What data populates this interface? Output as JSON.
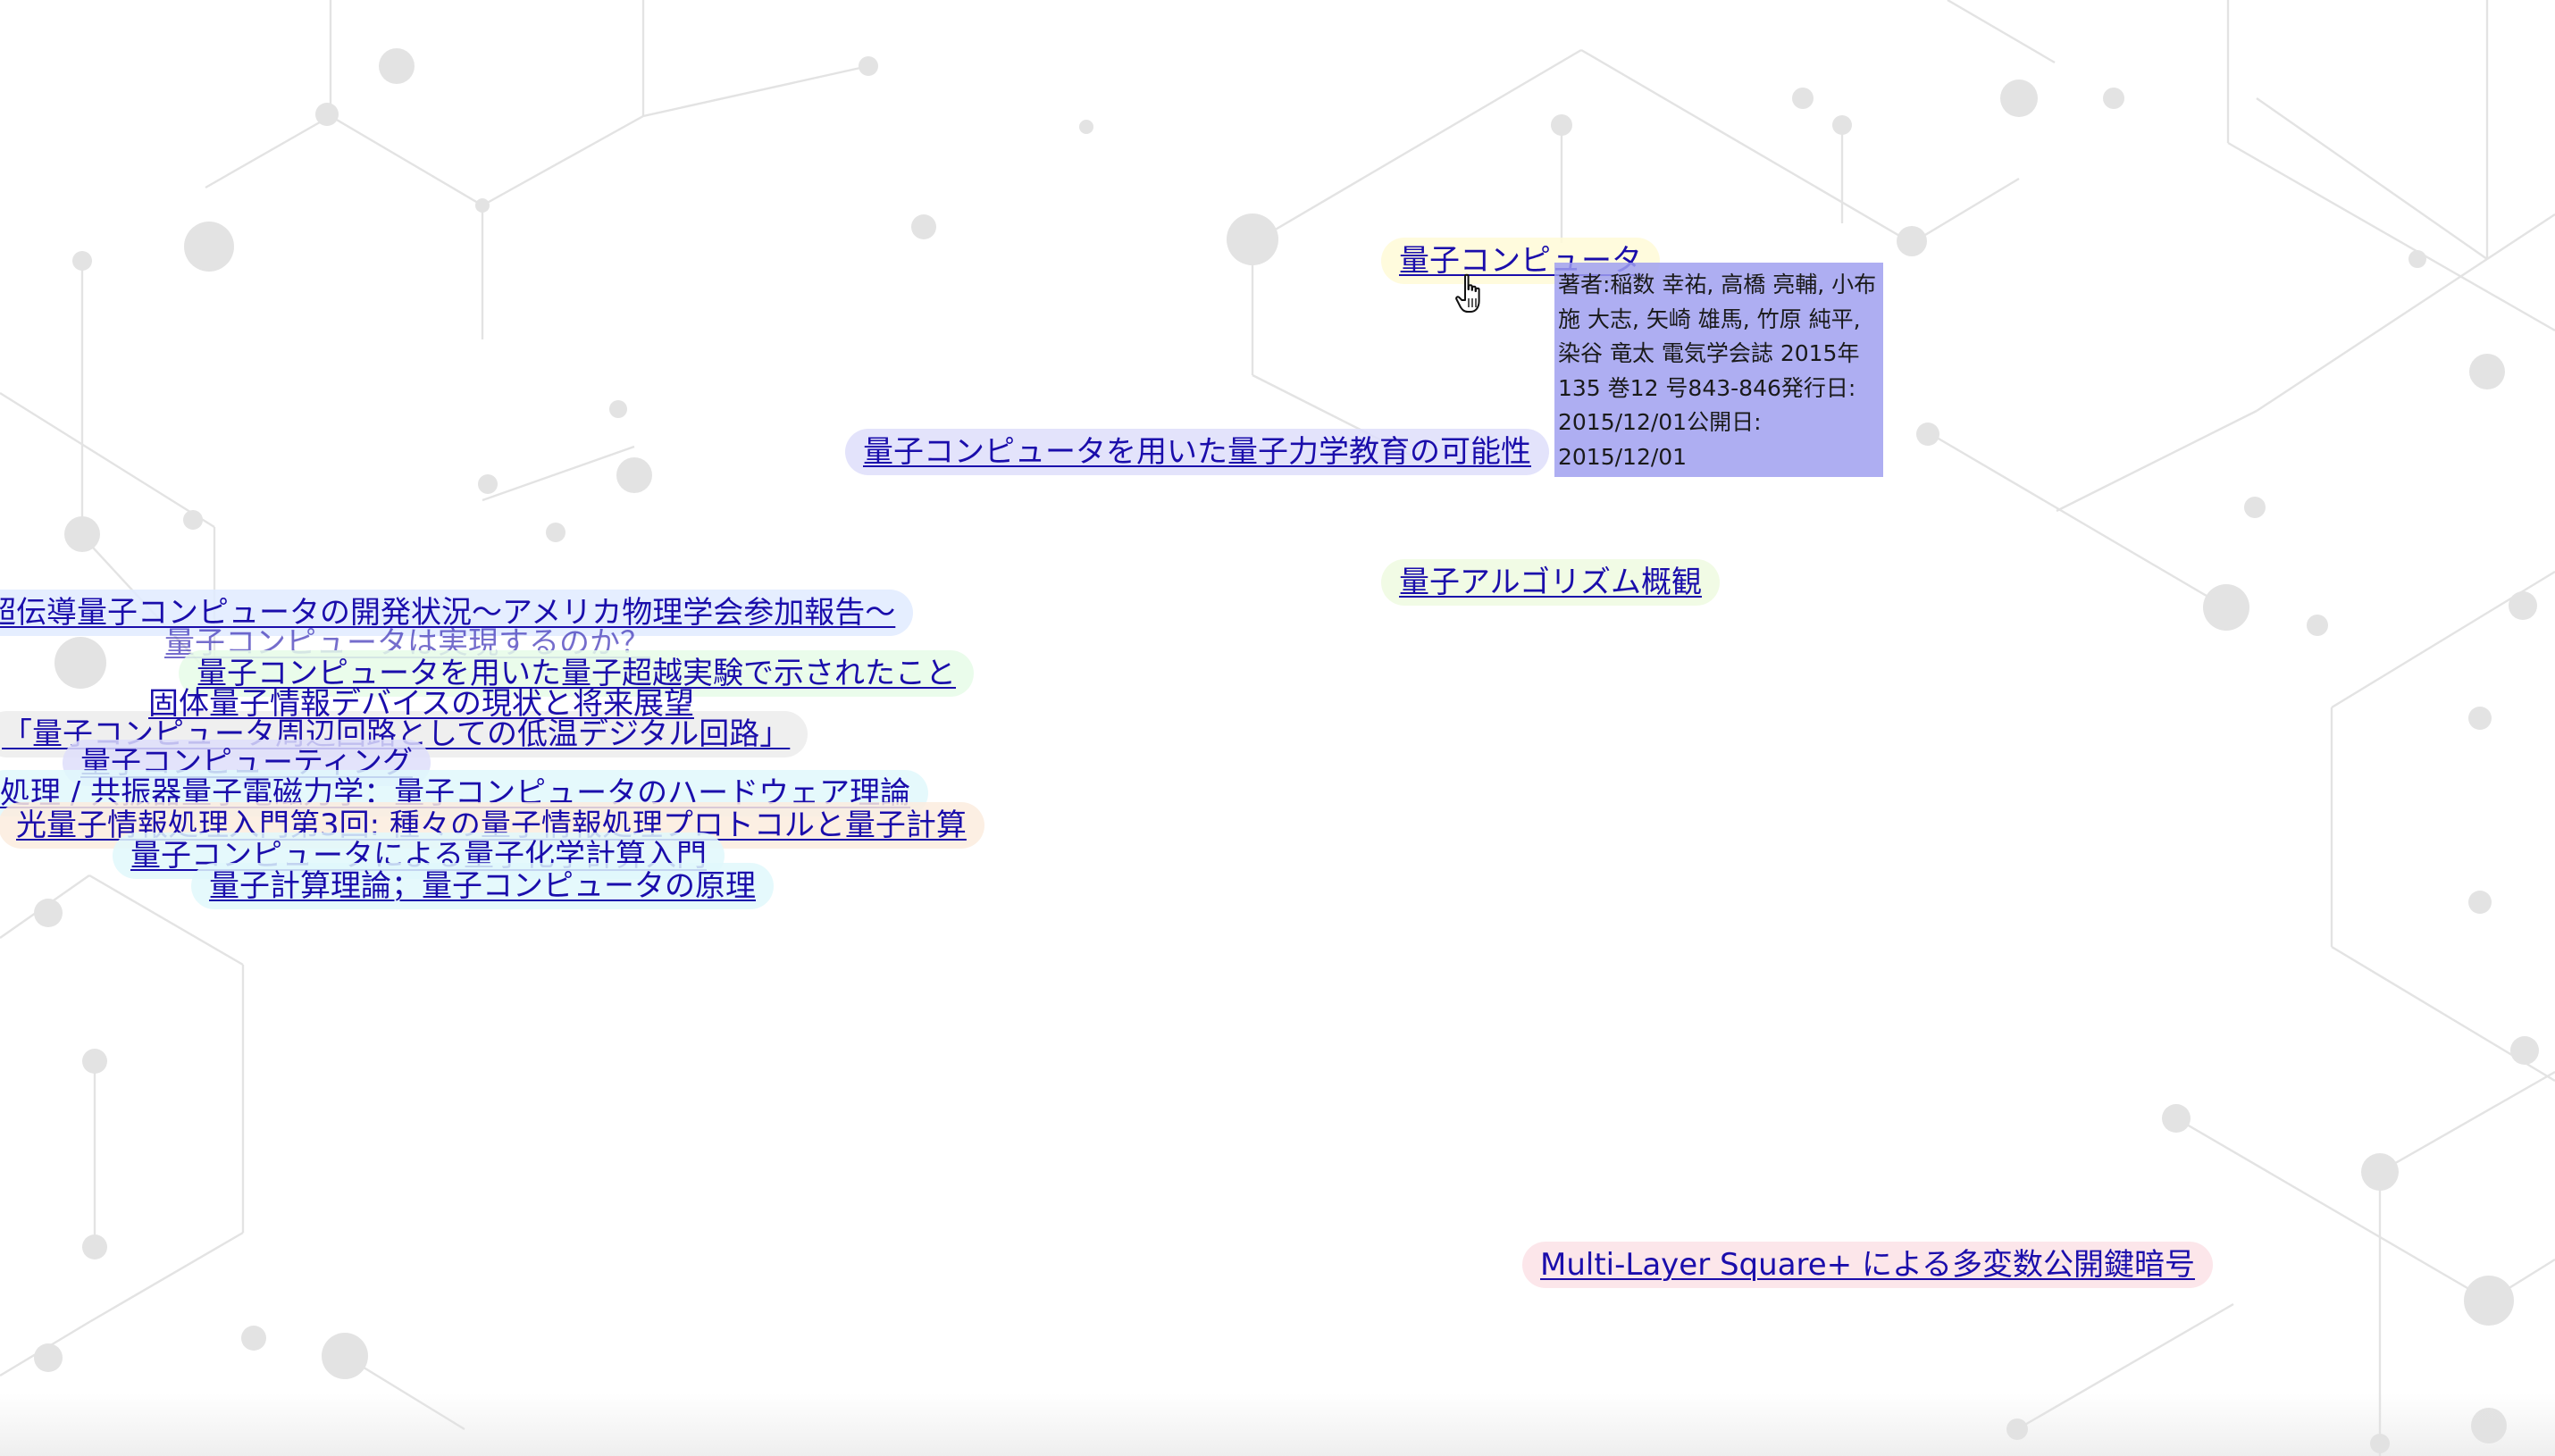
{
  "links": [
    {
      "id": "quantum-computer",
      "text": "量子コンピュータ",
      "color": "yellow",
      "hovered": true
    },
    {
      "id": "qc-education",
      "text": "量子コンピュータを用いた量子力学教育の可能性",
      "color": "lavender"
    },
    {
      "id": "quantum-algorithm-overview",
      "text": "量子アルゴリズム概観",
      "color": "lime"
    },
    {
      "id": "superconducting-qc-status",
      "text": "超伝導量子コンピュータの開発状況〜アメリカ物理学会参加報告〜",
      "color": "blue"
    },
    {
      "id": "will-qc-be-realized",
      "text": "量子コンピュータは実現するのか？",
      "color": "none"
    },
    {
      "id": "quantum-supremacy-experiment",
      "text": "量子コンピュータを用いた量子超越実験で示されたこと",
      "color": "mint"
    },
    {
      "id": "solid-state-quantum-devices",
      "text": "固体量子情報デバイスの現状と将来展望",
      "color": "none"
    },
    {
      "id": "cryo-digital-circuits",
      "text": "「量子コンピュータ周辺回路としての低温デジタル回路」",
      "color": "gray"
    },
    {
      "id": "quantum-computing",
      "text": "量子コンピューティング",
      "color": "lavender"
    },
    {
      "id": "qc-hardware-theory",
      "text": "処理 / 共振器量子電磁力学：量子コンピュータのハードウェア理論",
      "color": "cyan"
    },
    {
      "id": "photonic-qip-3",
      "text": "光量子情報処理入門第3回: 種々の量子情報処理プロトコルと量子計算",
      "color": "peach"
    },
    {
      "id": "quantum-chemistry-intro",
      "text": "量子コンピュータによる量子化学計算入門",
      "color": "cyan"
    },
    {
      "id": "quantum-computation-theory",
      "text": "量子計算理論；量子コンピュータの原理",
      "color": "cyan"
    },
    {
      "id": "multilayer-square-pke",
      "text": "Multi-Layer Square+ による多変数公開鍵暗号",
      "color": "pink"
    }
  ],
  "tooltip": {
    "text": "著者:稲数 幸祐, 高橋 亮輔, 小布施 大志, 矢崎 雄馬, 竹原 純平, 染谷 竜太 電気学会誌 2015年 135 巻12 号843-846発行日: 2015/12/01公開日: 2015/12/01"
  },
  "colors": {
    "link_text": "#1a0dab",
    "tooltip_bg": "#a0a0f0",
    "network": "#e3e3e3"
  },
  "icons": {
    "cursor": "hand-pointer-icon",
    "background": "molecular-network"
  }
}
